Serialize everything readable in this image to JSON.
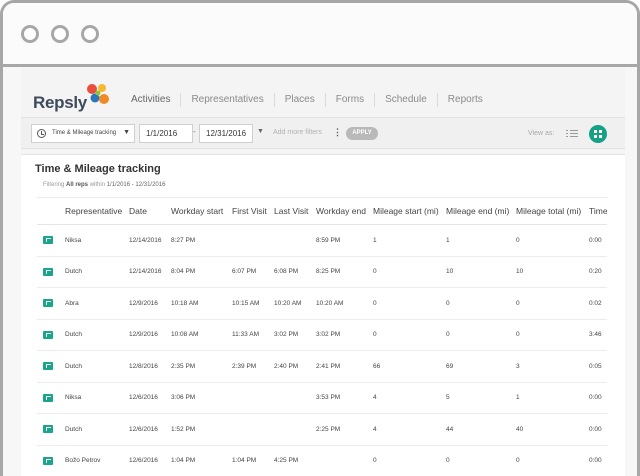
{
  "brand": {
    "name": "Repsly"
  },
  "nav": {
    "items": [
      {
        "label": "Activities",
        "active": true
      },
      {
        "label": "Representatives"
      },
      {
        "label": "Places"
      },
      {
        "label": "Forms"
      },
      {
        "label": "Schedule"
      },
      {
        "label": "Reports"
      }
    ]
  },
  "filters": {
    "report_type": "Time & Mileage tracking",
    "date_from": "1/1/2016",
    "date_to": "12/31/2016",
    "add_more": "Add more filters",
    "apply_label": "APPLY",
    "view_as": "View as:"
  },
  "report": {
    "title": "Time & Mileage tracking",
    "subtitle_prefix": "Filtering",
    "subtitle_reps": "All reps",
    "subtitle_within": "within",
    "subtitle_range": "1/1/2016 - 12/31/2016"
  },
  "table": {
    "columns": [
      "Representative",
      "Date",
      "Workday start",
      "First Visit",
      "Last Visit",
      "Workday end",
      "Mileage start (mi)",
      "Mileage end (mi)",
      "Mileage total (mi)",
      "Time"
    ],
    "rows": [
      [
        "Niksa",
        "12/14/2016",
        "8:27 PM",
        "",
        "",
        "8:59 PM",
        "1",
        "1",
        "0",
        "0:00"
      ],
      [
        "Dutch",
        "12/14/2016",
        "8:04 PM",
        "6:07 PM",
        "6:08 PM",
        "8:25 PM",
        "0",
        "10",
        "10",
        "0:20"
      ],
      [
        "Abra",
        "12/9/2016",
        "10:18 AM",
        "10:15 AM",
        "10:20 AM",
        "10:20 AM",
        "0",
        "0",
        "0",
        "0:02"
      ],
      [
        "Dutch",
        "12/9/2016",
        "10:08 AM",
        "11:33 AM",
        "3:02 PM",
        "3:02 PM",
        "0",
        "0",
        "0",
        "3:46"
      ],
      [
        "Dutch",
        "12/8/2016",
        "2:35 PM",
        "2:39 PM",
        "2:40 PM",
        "2:41 PM",
        "66",
        "69",
        "3",
        "0:05"
      ],
      [
        "Niksa",
        "12/6/2016",
        "3:06 PM",
        "",
        "",
        "3:53 PM",
        "4",
        "5",
        "1",
        "0:00"
      ],
      [
        "Dutch",
        "12/6/2016",
        "1:52 PM",
        "",
        "",
        "2:25 PM",
        "4",
        "44",
        "40",
        "0:00"
      ],
      [
        "Božo Petrov",
        "12/6/2016",
        "1:04 PM",
        "1:04 PM",
        "4:25 PM",
        "",
        "0",
        "0",
        "0",
        "0:00"
      ]
    ]
  },
  "colors": {
    "accent": "#16a085",
    "flag": "#17a689"
  }
}
